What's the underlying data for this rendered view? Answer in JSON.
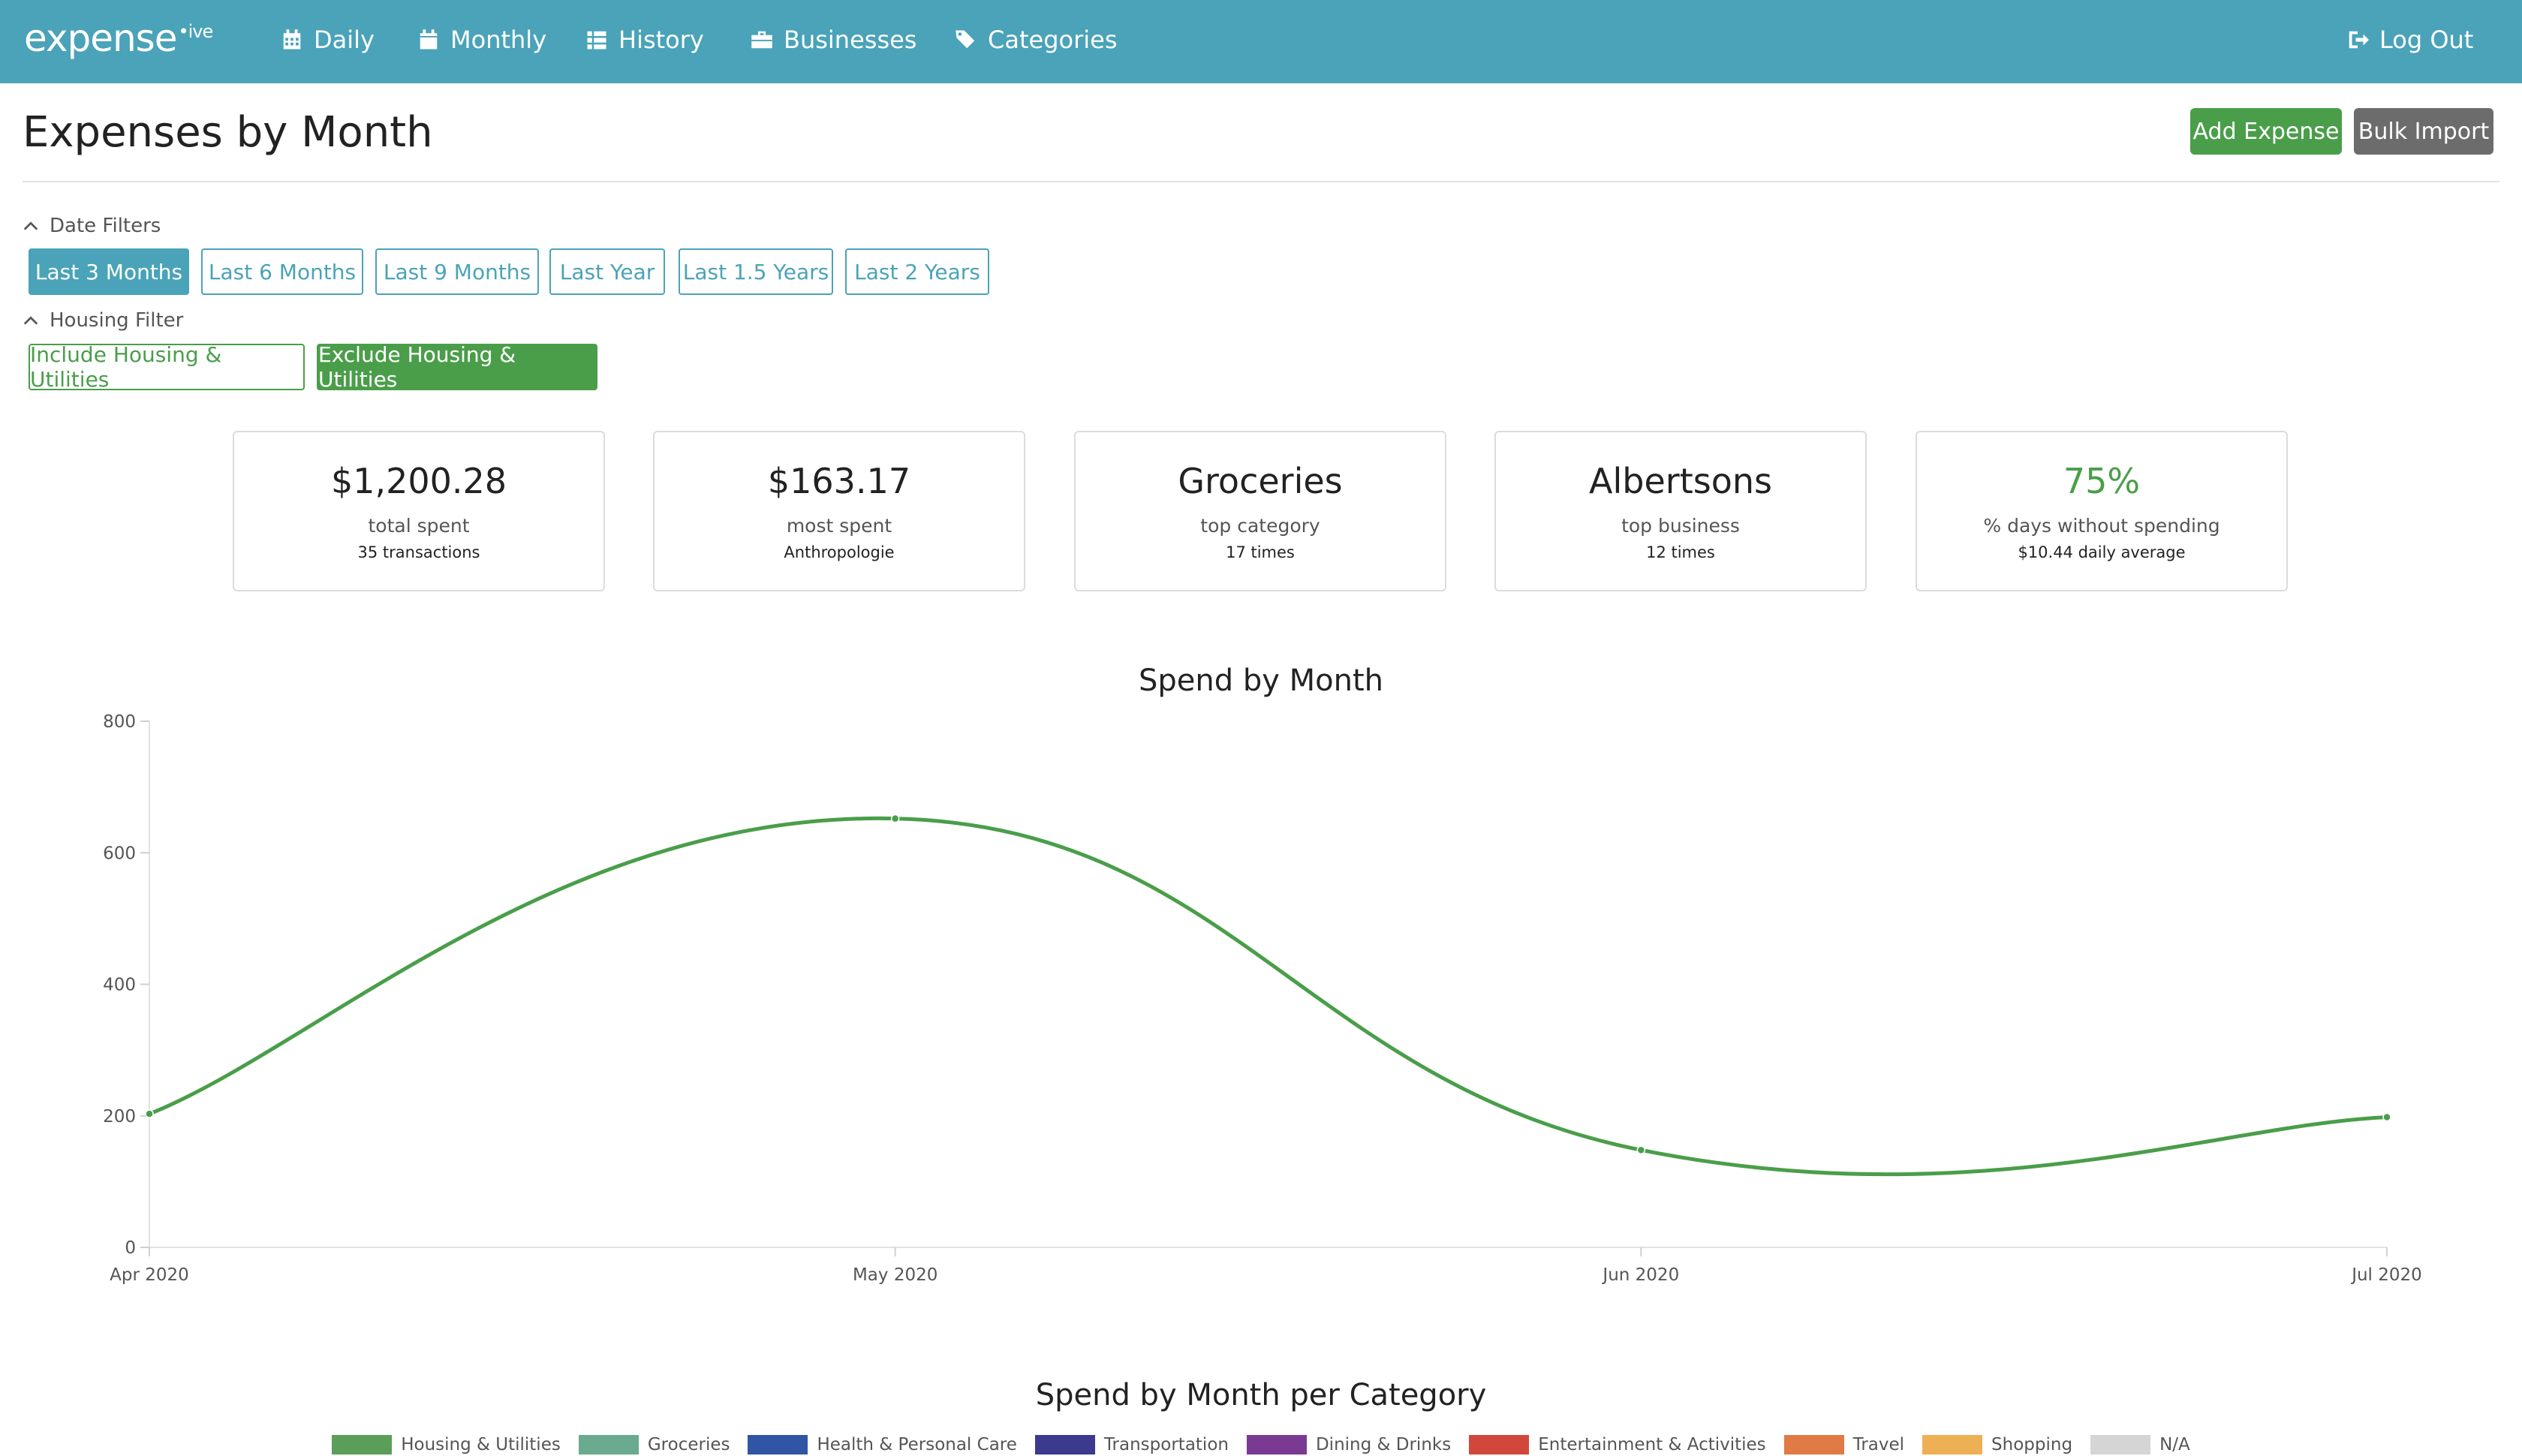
{
  "nav": {
    "brand": "expense",
    "brand_sup": "•ive",
    "items": [
      {
        "label": "Daily",
        "icon": "calendar-grid-icon"
      },
      {
        "label": "Monthly",
        "icon": "calendar-icon"
      },
      {
        "label": "History",
        "icon": "list-icon"
      },
      {
        "label": "Businesses",
        "icon": "briefcase-icon"
      },
      {
        "label": "Categories",
        "icon": "tags-icon"
      }
    ],
    "logout": "Log Out"
  },
  "header": {
    "title": "Expenses by Month",
    "add_expense": "Add Expense",
    "bulk_import": "Bulk Import"
  },
  "date_filters": {
    "label": "Date Filters",
    "options": [
      "Last 3 Months",
      "Last 6 Months",
      "Last 9 Months",
      "Last Year",
      "Last 1.5 Years",
      "Last 2 Years"
    ],
    "selected": "Last 3 Months"
  },
  "housing_filter": {
    "label": "Housing Filter",
    "options": [
      "Include Housing & Utilities",
      "Exclude Housing & Utilities"
    ],
    "selected": "Exclude Housing & Utilities"
  },
  "stats": [
    {
      "value": "$1,200.28",
      "label": "total spent",
      "sub": "35 transactions"
    },
    {
      "value": "$163.17",
      "label": "most spent",
      "sub": "Anthropologie"
    },
    {
      "value": "Groceries",
      "label": "top category",
      "sub": "17 times"
    },
    {
      "value": "Albertsons",
      "label": "top business",
      "sub": "12 times"
    },
    {
      "value": "75%",
      "label": "% days without spending",
      "sub": "$10.44 daily average",
      "accent": "#4a9e4a"
    }
  ],
  "chart_data": {
    "type": "line",
    "title": "Spend by Month",
    "categories": [
      "Apr 2020",
      "May 2020",
      "Jun 2020",
      "Jul 2020"
    ],
    "values": [
      203,
      652,
      148,
      198
    ],
    "ylim": [
      0,
      800
    ],
    "yticks": [
      0,
      200,
      400,
      600,
      800
    ],
    "color": "#4a9e4a",
    "smooth": true,
    "grid": false
  },
  "category_chart": {
    "title": "Spend by Month per Category",
    "legend": [
      {
        "name": "Housing & Utilities",
        "color": "#5a9e5a"
      },
      {
        "name": "Groceries",
        "color": "#6aaa8e"
      },
      {
        "name": "Health & Personal Care",
        "color": "#2f55a4"
      },
      {
        "name": "Transportation",
        "color": "#3b3a8f"
      },
      {
        "name": "Dining & Drinks",
        "color": "#7a3a94"
      },
      {
        "name": "Entertainment & Activities",
        "color": "#d2473c"
      },
      {
        "name": "Travel",
        "color": "#e07b45"
      },
      {
        "name": "Shopping",
        "color": "#eeb055"
      },
      {
        "name": "N/A",
        "color": "#d5d5d5"
      }
    ]
  }
}
